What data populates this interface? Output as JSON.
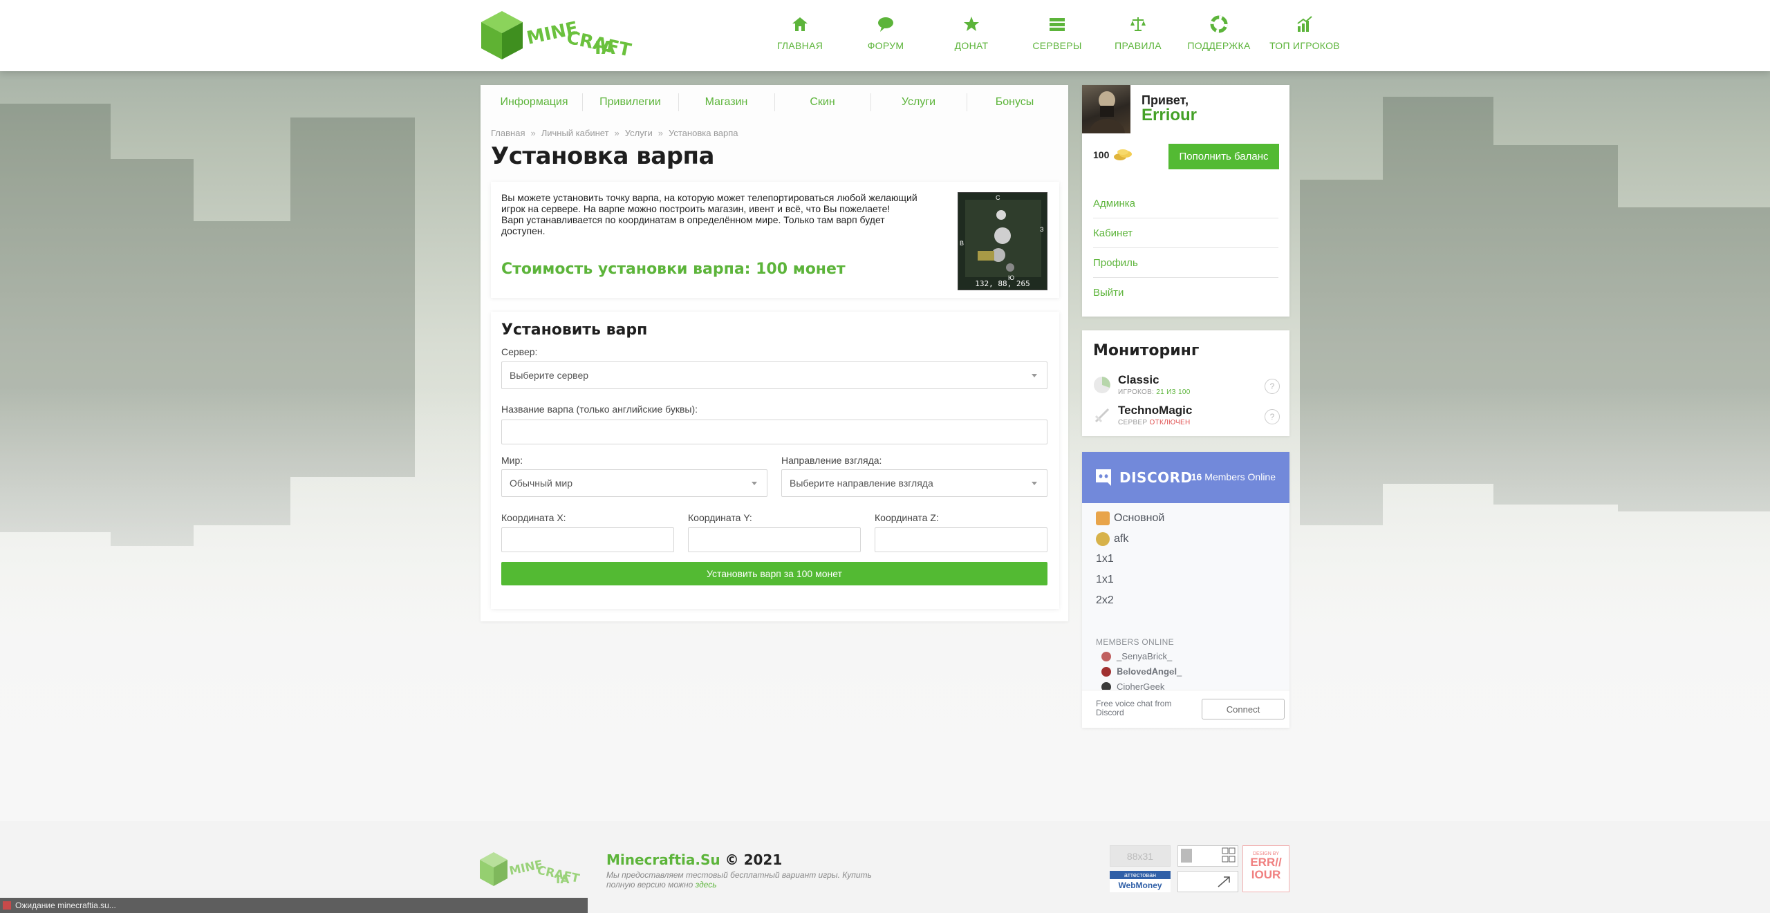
{
  "header": {
    "logo_text": "MINECRAFTIA",
    "nav": [
      {
        "label": "ГЛАВНАЯ",
        "icon": "home-icon"
      },
      {
        "label": "ФОРУМ",
        "icon": "chat-icon"
      },
      {
        "label": "ДОНАТ",
        "icon": "star-icon"
      },
      {
        "label": "СЕРВЕРЫ",
        "icon": "server-list-icon"
      },
      {
        "label": "ПРАВИЛА",
        "icon": "scales-icon"
      },
      {
        "label": "ПОДДЕРЖКА",
        "icon": "lifebuoy-icon"
      },
      {
        "label": "ТОП ИГРОКОВ",
        "icon": "chart-icon"
      }
    ]
  },
  "tabs": [
    "Информация",
    "Привилегии",
    "Магазин",
    "Скин",
    "Услуги",
    "Бонусы"
  ],
  "breadcrumb": [
    "Главная",
    "Личный кабинет",
    "Услуги",
    "Установка варпа"
  ],
  "page_title": "Установка варпа",
  "info": {
    "line1": "Вы можете установить точку варпа, на которую может телепортироваться любой желающий игрок на сервере. На варпе можно построить магазин, ивент и всё, что Вы пожелаете!",
    "line2": "Варп устанавливается по координатам в определённом мире. Только там варп будет доступен.",
    "cost": "Стоимость установки варпа: 100 монет",
    "image_coords": "132, 88, 265"
  },
  "form": {
    "title": "Установить варп",
    "server_label": "Сервер:",
    "server_value": "Выберите сервер",
    "name_label": "Название варпа (только английские буквы):",
    "name_value": "",
    "world_label": "Мир:",
    "world_value": "Обычный мир",
    "direction_label": "Направление взгляда:",
    "direction_value": "Выберите направление взгляда",
    "x_label": "Координата X:",
    "y_label": "Координата Y:",
    "z_label": "Координата Z:",
    "submit": "Установить варп за 100 монет"
  },
  "user": {
    "greeting": "Привет,",
    "name": "Erriour",
    "balance": "100",
    "topup": "Пополнить баланс",
    "menu": [
      "Админка",
      "Кабинет",
      "Профиль",
      "Выйти"
    ]
  },
  "monitoring": {
    "title": "Мониторинг",
    "servers": [
      {
        "name": "Classic",
        "status_prefix": "ИГРОКОВ:",
        "status_value": "21 ИЗ 100",
        "status_color": "#5cb43a"
      },
      {
        "name": "TechnoMagic",
        "status_prefix": "СЕРВЕР",
        "status_value": "ОТКЛЮЧЕН",
        "status_color": "#e05050"
      }
    ]
  },
  "discord": {
    "brand": "DISCORD",
    "online_count": "16",
    "online_label": "Members Online",
    "channels": [
      "Основной",
      "afk",
      "1x1",
      "1x1",
      "2x2"
    ],
    "members_title": "MEMBERS ONLINE",
    "members": [
      "_SenyaBrick_",
      "𝐁𝐞𝐥𝐨𝐯𝐞𝐝𝐀𝐧𝐠𝐞𝐥_",
      "CipherGeek"
    ],
    "footer_text": "Free voice chat from Discord",
    "connect": "Connect"
  },
  "footer": {
    "site": "Minecraftia.Su",
    "copyright": "© 2021",
    "note_text": "Мы предоставляем тестовый бесплатный вариант игры. Купить полную версию можно",
    "note_link": "здесь",
    "counter_badge": "88x31",
    "webmoney_top": "аттестован",
    "webmoney_bottom": "WebMoney",
    "design_badge_top": "DESIGN BY",
    "design_badge_line1": "ERR//",
    "design_badge_line2": "IOUR"
  },
  "status_bar": "Ожидание minecraftia.su...",
  "colors": {
    "accent": "#5cb43a",
    "button": "#53ba33",
    "discord": "#7289da"
  }
}
